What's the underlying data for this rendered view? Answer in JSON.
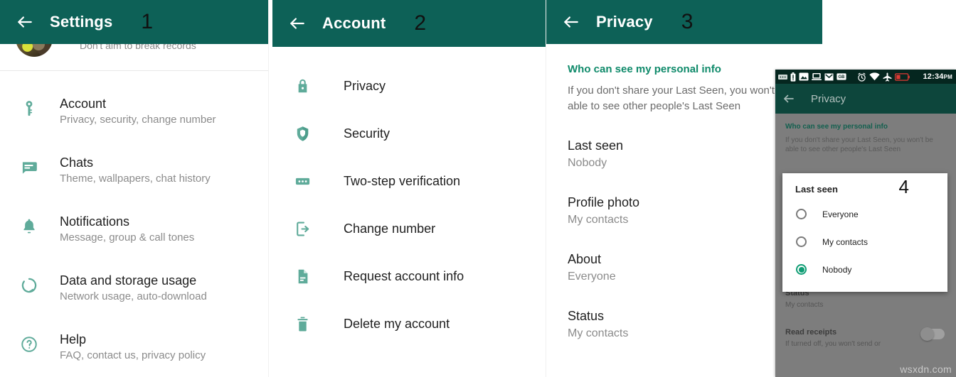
{
  "meta": {
    "app": "WhatsApp",
    "accent_green": "#0d6157",
    "icon_teal": "#5fab9a",
    "link_green": "#0f8a6a",
    "watermark": "wsxdn.com"
  },
  "panel1": {
    "step": "1",
    "title": "Settings",
    "back_icon": "arrow-left-icon",
    "profile": {
      "subtitle": "Don't aim to break records"
    },
    "items": [
      {
        "icon": "key-icon",
        "title": "Account",
        "subtitle": "Privacy, security, change number"
      },
      {
        "icon": "chat-icon",
        "title": "Chats",
        "subtitle": "Theme, wallpapers, chat history"
      },
      {
        "icon": "bell-icon",
        "title": "Notifications",
        "subtitle": "Message, group & call tones"
      },
      {
        "icon": "data-usage-icon",
        "title": "Data and storage usage",
        "subtitle": "Network usage, auto-download"
      },
      {
        "icon": "help-icon",
        "title": "Help",
        "subtitle": "FAQ, contact us, privacy policy"
      }
    ]
  },
  "panel2": {
    "step": "2",
    "title": "Account",
    "back_icon": "arrow-left-icon",
    "items": [
      {
        "icon": "lock-icon",
        "label": "Privacy"
      },
      {
        "icon": "shield-icon",
        "label": "Security"
      },
      {
        "icon": "two-step-icon",
        "label": "Two-step verification"
      },
      {
        "icon": "change-number-icon",
        "label": "Change number"
      },
      {
        "icon": "document-icon",
        "label": "Request account info"
      },
      {
        "icon": "trash-icon",
        "label": "Delete my account"
      }
    ]
  },
  "panel3": {
    "step": "3",
    "title": "Privacy",
    "back_icon": "arrow-left-icon",
    "section_head": "Who can see my personal info",
    "section_desc": "If you don't share your Last Seen, you won't be able to see other people's Last Seen",
    "items": [
      {
        "title": "Last seen",
        "value": "Nobody"
      },
      {
        "title": "Profile photo",
        "value": "My contacts"
      },
      {
        "title": "About",
        "value": "Everyone"
      },
      {
        "title": "Status",
        "value": "My contacts"
      }
    ]
  },
  "panel4": {
    "step": "4",
    "statusbar": {
      "time": "12:34",
      "ampm": "PM",
      "icons": [
        "more-icon",
        "battery-icon",
        "screenshot-icon",
        "computer-icon",
        "gmail-icon",
        "gb-keyboard-icon",
        "alarm-icon",
        "wifi-icon",
        "airplane-mode-icon",
        "battery-low-icon"
      ]
    },
    "title": "Privacy",
    "back_icon": "arrow-left-icon",
    "section_head": "Who can see my personal info",
    "section_desc": "If you don't share your Last Seen, you won't be able to see other people's Last Seen",
    "dialog": {
      "title": "Last seen",
      "options": [
        {
          "label": "Everyone",
          "selected": false
        },
        {
          "label": "My contacts",
          "selected": false
        },
        {
          "label": "Nobody",
          "selected": true
        }
      ]
    },
    "below": {
      "status_title": "Status",
      "status_value": "My contacts",
      "read_receipts_title": "Read receipts",
      "read_receipts_desc": "If turned off, you won't send or",
      "read_receipts_on": false
    }
  }
}
